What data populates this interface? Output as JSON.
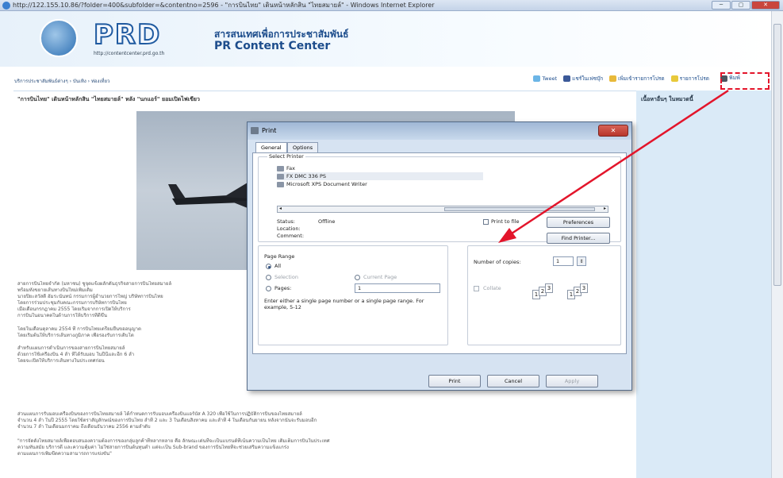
{
  "browser": {
    "title": "http://122.155.10.86/?folder=400&subfolder=&contentno=2596 - \"การบินไทย\" เดินหน้าหลักสิน \"ไทยสมายล์\" - Windows Internet Explorer",
    "buttons": [
      "─",
      "▢",
      "✕"
    ]
  },
  "site": {
    "logo": "PRD",
    "logo_url": "http://contentcenter.prd.go.th",
    "name_th": "สารสนเทศเพื่อการประชาสัมพันธ์",
    "name_en": "PR Content Center"
  },
  "toolbar": {
    "breadcrumb": "บริการประชาสัมพันธ์ต่างๆ › บันเทิง › ท่องเที่ยว",
    "tweet": "Tweet",
    "facebook": "แชร์ในเฟซบุ๊ก",
    "bookmark": "เพิ่มเข้ารายการโปรด",
    "favorite": "รายการโปรด",
    "print": "พิมพ์"
  },
  "article": {
    "title": "\"การบินไทย\" เดินหน้าหลักสิน \"ไทยสมายล์\" หลัง \"นกแอร์\" ยอมเปิดไฟเขียว",
    "paragraphs": [
      "สายการบินไทยจำกัด (มหาชน) ชูจุดแข็งผลักดันธุรกิจสายการบินไทยสมายล์",
      "พร้อมทั้งขยายเส้นทางบินใหม่เพิ่มเติม",
      "นายปิยะสวัสดิ์ อัมระนันทน์ กรรมการผู้อำนวยการใหญ่ บริษัทการบินไทย",
      "โดยการร่วมประชุมกับคณะกรรมการบริษัทการบินไทย",
      "เมื่อเดือนกรกฎาคม 2555 โดยเริ่มจากการเปิดให้บริการ",
      "การบินในอนาคตในด้านการให้บริการที่ดีขึ้น",
      "โดยในเดือนตุลาคม 2554 ที่ การบินไทยเตรียมยื่นขออนุญาต",
      "โดยเริ่มต้นให้บริการเส้นทางภูมิภาค เพื่อรองรับการเติบโต",
      "สำหรับแผนการดำเนินการของสายการบินไทยสมายล์",
      "ด้วยการใช้เครื่องบิน 4 ลำ ที่ได้รับมอบ ในปีนี้และอีก 6 ลำ",
      "โดยจะเปิดให้บริการเส้นทางในประเทศก่อน",
      "ส่วนแผนการรับมอบเครื่องบินของการบินไทยสมายล์ ได้กำหนดการรับมอบเครื่องบินแอร์บัส A 320 เพื่อใช้ในการปฏิบัติการบินของไทยสมายล์",
      "จำนวน 4 ลำ ในปี 2555 โดยใช้ตราสัญลักษณ์ของการบินไทย ลำที่ 2 และ 3 ในเดือนสิงหาคม และลำที่ 4 ในเดือนกันยายน หลังจากนั้นจะรับมอบอีก",
      "จำนวน 7 ลำ ในเดือนมกราคม ถึงเดือนธันวาคม 2556 ตามลำดับ",
      "\"การจัดตั้งไทยสมายล์เพื่อตอบสนองความต้องการของกลุ่มลูกค้าที่หลากหลาย คือ ลักษณะเด่นที่จะเป็นแบรนด์ที่เน้นความเป็นไทย เติมเต็มการบินในประเทศ",
      "ความทันสมัย บริการดี และความคุ้มค่า ไม่ใช่สายการบินต้นทุนต่ำ แต่จะเป็น Sub-brand ของการบินไทยที่จะช่วยเสริมความแข็งแกร่ง",
      "ตามแผนการเพิ่มขีดความสามารถการแข่งขัน\""
    ]
  },
  "sidebar": {
    "title": "เนื้อหาอื่นๆ ในหมวดนี้"
  },
  "print_dialog": {
    "title": "Print",
    "close": "✕",
    "tabs": [
      "General",
      "Options"
    ],
    "select_printer_label": "Select Printer",
    "printers": [
      "Fax",
      "FX DMC 336 PS",
      "Microsoft XPS Document Writer"
    ],
    "selected_printer": "FX DMC 336 PS",
    "status_label": "Status:",
    "status_value": "Offline",
    "location_label": "Location:",
    "comment_label": "Comment:",
    "print_to_file": "Print to file",
    "preferences_button": "Preferences",
    "find_printer_button": "Find Printer...",
    "page_range_label": "Page Range",
    "range_all": "All",
    "range_selection": "Selection",
    "range_current": "Current Page",
    "range_pages": "Pages:",
    "pages_value": "1",
    "hint_text": "Enter either a single page number or a single page range.  For example, 5-12",
    "copies_label": "Number of copies:",
    "copies_value": "1",
    "collate_label": "Collate",
    "collate_pages": [
      "1",
      "2",
      "3",
      "1",
      "2",
      "3"
    ],
    "print_button": "Print",
    "cancel_button": "Cancel",
    "apply_button": "Apply"
  },
  "annotation": {
    "highlight_color": "#e3152b",
    "arrow_color": "#e3152b"
  }
}
